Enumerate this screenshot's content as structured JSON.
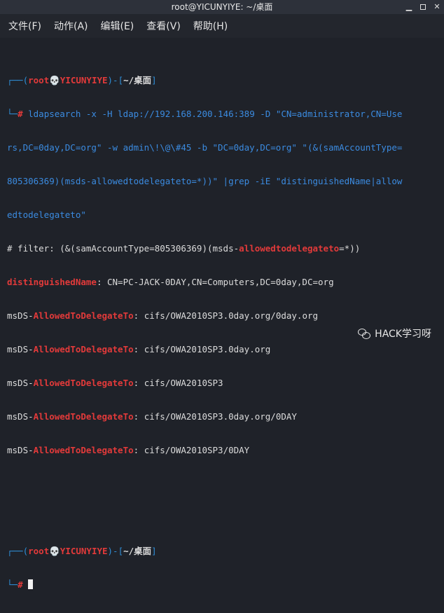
{
  "window": {
    "title": "root@YICUNYIYE: ~/桌面",
    "controls": [
      "minimize",
      "maximize",
      "close"
    ]
  },
  "menu": {
    "items": [
      "文件(F)",
      "动作(A)",
      "编辑(E)",
      "查看(V)",
      "帮助(H)"
    ]
  },
  "terminal": {
    "prompt1": {
      "open": "┌──(",
      "user": "root",
      "skull": "💀",
      "host": "YICUNYIYE",
      "sep": ")-[",
      "path": "~/桌面",
      "close": "]",
      "hash_prefix": "└─",
      "hash": "#"
    },
    "cmd_line1": " ldapsearch -x -H ldap://192.168.200.146:389 -D \"CN=administrator,CN=Use",
    "cmd_line2": "rs,DC=0day,DC=org\" -w admin\\!\\@\\#45 -b \"DC=0day,DC=org\" \"(&(samAccountType=",
    "cmd_line3": "805306369)(msds-allowedtodelegateto=*))\" |grep -iE \"distinguishedName|allow",
    "cmd_line4": "edtodelegateto\"",
    "filter_prefix": "# filter: (&(samAccountType=805306369)(msds-",
    "filter_hl": "allowedtodelegateto",
    "filter_suffix": "=*))",
    "dn_key": "distinguishedName",
    "dn_value": ": CN=PC-JACK-0DAY,CN=Computers,DC=0day,DC=org",
    "msds_prefix": "msDS-",
    "msds_key": "AllowedToDelegateTo",
    "results": [
      ": cifs/OWA2010SP3.0day.org/0day.org",
      ": cifs/OWA2010SP3.0day.org",
      ": cifs/OWA2010SP3",
      ": cifs/OWA2010SP3.0day.org/0DAY",
      ": cifs/OWA2010SP3/0DAY"
    ]
  },
  "watermark": {
    "text": "HACK学习呀"
  }
}
